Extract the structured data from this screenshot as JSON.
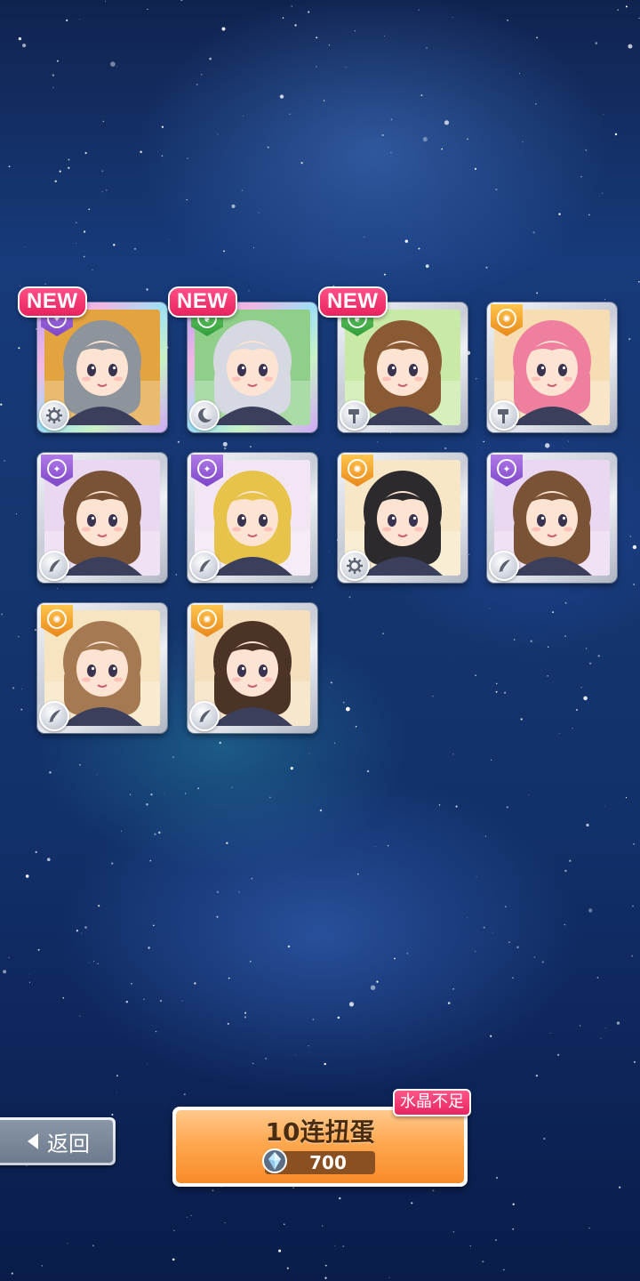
{
  "cards": [
    {
      "new": true,
      "frame": "rainbow",
      "attribute": "purple",
      "attribute_icon": "cool-icon",
      "skill_icon": "gear-icon",
      "hair": "#8e949c",
      "bg": "#e3a33f"
    },
    {
      "new": true,
      "frame": "rainbow",
      "attribute": "green",
      "attribute_icon": "leaf-icon",
      "skill_icon": "moon-icon",
      "hair": "#d6d8e2",
      "bg": "#8fcf8a"
    },
    {
      "new": true,
      "frame": "silver",
      "attribute": "green",
      "attribute_icon": "leaf-icon",
      "skill_icon": "hammer-icon",
      "hair": "#8a5a34",
      "bg": "#c9eaa6"
    },
    {
      "new": false,
      "frame": "silver",
      "attribute": "orange",
      "attribute_icon": "passion-icon",
      "skill_icon": "hammer-icon",
      "hair": "#ef7f9e",
      "bg": "#f7ddb4"
    },
    {
      "new": false,
      "frame": "silver",
      "attribute": "purple",
      "attribute_icon": "cool-icon",
      "skill_icon": "rocket-icon",
      "hair": "#7a5236",
      "bg": "#ead8f2"
    },
    {
      "new": false,
      "frame": "silver",
      "attribute": "purple",
      "attribute_icon": "cool-icon",
      "skill_icon": "rocket-icon",
      "hair": "#e8c34a",
      "bg": "#f2e6f5"
    },
    {
      "new": false,
      "frame": "silver",
      "attribute": "orange",
      "attribute_icon": "passion-icon",
      "skill_icon": "gear-icon",
      "hair": "#2d2a2e",
      "bg": "#f7e7c6"
    },
    {
      "new": false,
      "frame": "silver",
      "attribute": "purple",
      "attribute_icon": "cool-icon",
      "skill_icon": "rocket-icon",
      "hair": "#7a5236",
      "bg": "#ead8f2"
    },
    {
      "new": false,
      "frame": "silver",
      "attribute": "orange",
      "attribute_icon": "passion-icon",
      "skill_icon": "rocket-icon",
      "hair": "#a57a52",
      "bg": "#f7e4c0"
    },
    {
      "new": false,
      "frame": "silver",
      "attribute": "orange",
      "attribute_icon": "passion-icon",
      "skill_icon": "rocket-icon",
      "hair": "#4b3326",
      "bg": "#f5dfbd"
    }
  ],
  "new_label": "NEW",
  "back_button": {
    "label": "返回",
    "icon": "back-arrow-icon"
  },
  "gacha_button": {
    "label": "10连扭蛋",
    "cost": "700",
    "currency_icon": "crystal-icon",
    "warning": "水晶不足"
  },
  "colors": {
    "new_badge": "#e8235f",
    "gacha_orange": "#f88a2a",
    "cost_pill": "#8a5022",
    "warning_badge": "#e62462"
  }
}
